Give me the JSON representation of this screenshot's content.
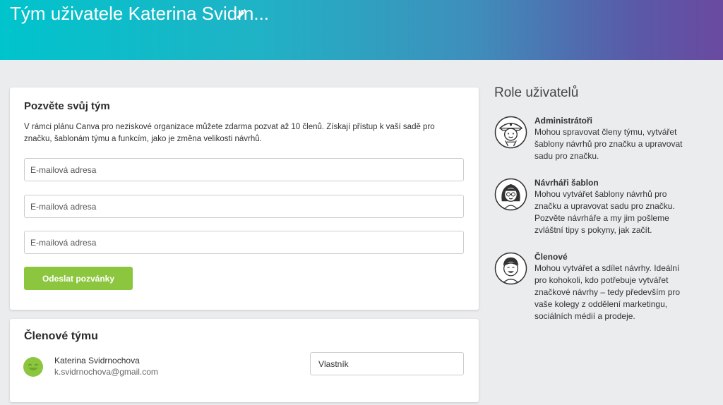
{
  "header": {
    "title": "Tým uživatele Katerina Svidrn...",
    "edit_icon": "pencil-icon"
  },
  "invite": {
    "title": "Pozvěte svůj tým",
    "description": "V rámci plánu Canva pro neziskové organizace můžete zdarma pozvat až 10 členů. Získají přístup k vaší sadě pro značku, šablonám týmu a funkcím, jako je změna velikosti návrhů.",
    "inputs": [
      {
        "placeholder": "E-mailová adresa",
        "value": ""
      },
      {
        "placeholder": "E-mailová adresa",
        "value": ""
      },
      {
        "placeholder": "E-mailová adresa",
        "value": ""
      }
    ],
    "send_label": "Odeslat pozvánky"
  },
  "members": {
    "title": "Členové týmu",
    "items": [
      {
        "name": "Katerina Svidrnochova",
        "email": "k.svidrnochova@gmail.com",
        "role": "Vlastník",
        "avatar": "smiley-avatar-icon"
      }
    ]
  },
  "roles": {
    "title": "Role uživatelů",
    "items": [
      {
        "name": "Administrátoři",
        "description": "Mohou spravovat členy týmu, vytvářet šablony návrhů pro značku a upravovat sadu pro značku.",
        "icon": "pirate-admin-icon"
      },
      {
        "name": "Návrháři šablon",
        "description": "Mohou vytvářet šablony návrhů pro značku a upravovat sadu pro značku. Pozvěte návrháře a my jim pošleme zvláštní tipy s pokyny, jak začít.",
        "icon": "designer-woman-icon"
      },
      {
        "name": "Členové",
        "description": "Mohou vytvářet a sdílet návrhy. Ideální pro kohokoli, kdo potřebuje vytvářet značkové návrhy – tedy především pro vaše kolegy z oddělení marketingu, sociálních médií a prodeje.",
        "icon": "member-man-icon"
      }
    ]
  },
  "colors": {
    "accent_green": "#8cc63f",
    "header_gradient_start": "#00c4cc",
    "header_gradient_end": "#6a4aa0"
  }
}
